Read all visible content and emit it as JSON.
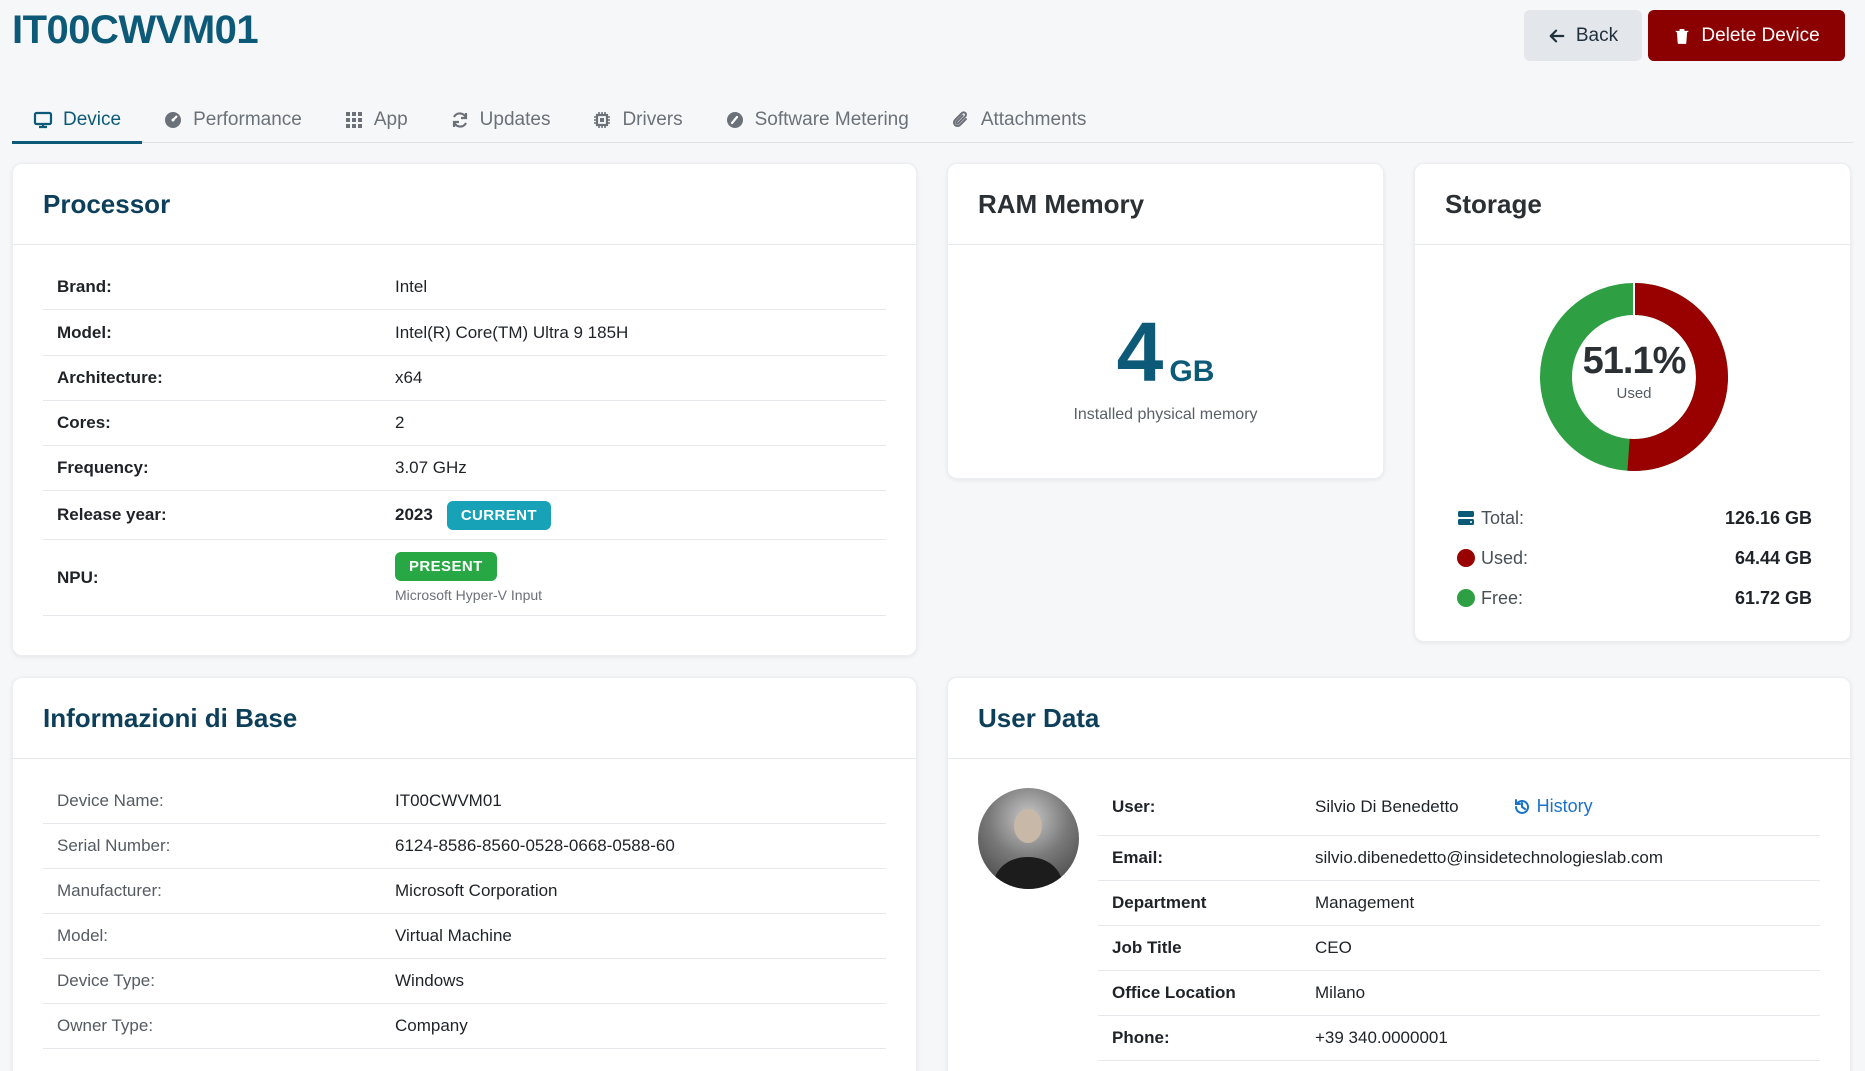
{
  "page_title": "IT00CWVM01",
  "actions": {
    "back_label": "Back",
    "delete_label": "Delete Device"
  },
  "tabs": [
    {
      "label": "Device",
      "icon": "monitor-icon"
    },
    {
      "label": "Performance",
      "icon": "gauge-icon"
    },
    {
      "label": "App",
      "icon": "grid-icon"
    },
    {
      "label": "Updates",
      "icon": "refresh-icon"
    },
    {
      "label": "Drivers",
      "icon": "chip-icon"
    },
    {
      "label": "Software Metering",
      "icon": "speedometer-icon"
    },
    {
      "label": "Attachments",
      "icon": "paperclip-icon"
    }
  ],
  "processor": {
    "title": "Processor",
    "rows": [
      {
        "key": "Brand:",
        "value": "Intel"
      },
      {
        "key": "Model:",
        "value": "Intel(R) Core(TM) Ultra 9 185H"
      },
      {
        "key": "Architecture:",
        "value": "x64"
      },
      {
        "key": "Cores:",
        "value": "2"
      },
      {
        "key": "Frequency:",
        "value": "3.07 GHz"
      },
      {
        "key": "Release year:",
        "value": "2023",
        "badge": "CURRENT"
      },
      {
        "key": "NPU:",
        "badge": "PRESENT",
        "sub": "Microsoft Hyper-V Input"
      }
    ]
  },
  "ram": {
    "title": "RAM Memory",
    "value": "4",
    "unit": "GB",
    "caption": "Installed physical memory"
  },
  "storage": {
    "title": "Storage",
    "used_percent_label": "51.1%",
    "used_caption": "Used",
    "used_fraction": 0.511,
    "colors": {
      "used": "#990000",
      "free": "#2ea043"
    },
    "total_label": "Total:",
    "total_value": "126.16 GB",
    "used_label": "Used:",
    "used_value": "64.44 GB",
    "free_label": "Free:",
    "free_value": "61.72 GB"
  },
  "basic_info": {
    "title": "Informazioni di Base",
    "rows": [
      {
        "key": "Device Name:",
        "value": "IT00CWVM01"
      },
      {
        "key": "Serial Number:",
        "value": "6124-8586-8560-0528-0668-0588-60"
      },
      {
        "key": "Manufacturer:",
        "value": "Microsoft Corporation"
      },
      {
        "key": "Model:",
        "value": "Virtual Machine"
      },
      {
        "key": "Device Type:",
        "value": "Windows"
      },
      {
        "key": "Owner Type:",
        "value": "Company"
      }
    ]
  },
  "user_data": {
    "title": "User Data",
    "history_label": "History",
    "rows": [
      {
        "key": "User:",
        "value": "Silvio Di Benedetto"
      },
      {
        "key": "Email:",
        "value": "silvio.dibenedetto@insidetechnologieslab.com"
      },
      {
        "key": "Department",
        "value": "Management"
      },
      {
        "key": "Job Title",
        "value": "CEO"
      },
      {
        "key": "Office Location",
        "value": "Milano"
      },
      {
        "key": "Phone:",
        "value": "+39 340.0000001"
      }
    ]
  }
}
